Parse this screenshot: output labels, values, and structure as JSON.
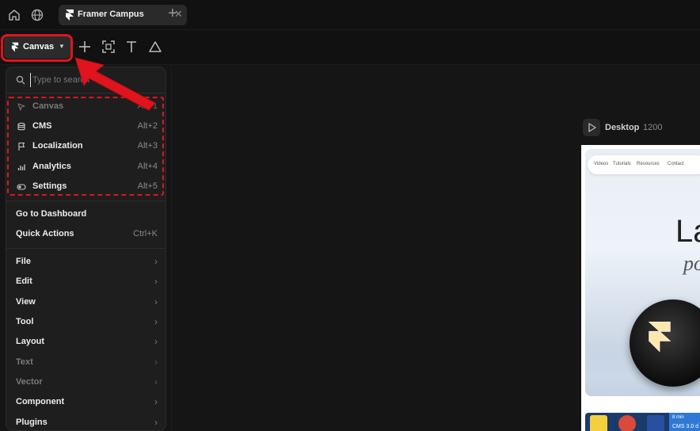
{
  "browser": {
    "tab_title": "Framer Campus",
    "tab_close": "✕",
    "new_tab": "+"
  },
  "toolbar": {
    "canvas_label": "Canvas",
    "chevron": "⌄"
  },
  "menu": {
    "search_placeholder": "Type to search",
    "modes": [
      {
        "label": "Canvas",
        "shortcut": "Alt+1",
        "icon": "pointer-icon"
      },
      {
        "label": "CMS",
        "shortcut": "Alt+2",
        "icon": "database-icon"
      },
      {
        "label": "Localization",
        "shortcut": "Alt+3",
        "icon": "flag-icon"
      },
      {
        "label": "Analytics",
        "shortcut": "Alt+4",
        "icon": "bar-chart-icon"
      },
      {
        "label": "Settings",
        "shortcut": "Alt+5",
        "icon": "toggle-icon"
      }
    ],
    "actions": [
      {
        "label": "Go to Dashboard",
        "shortcut": ""
      },
      {
        "label": "Quick Actions",
        "shortcut": "Ctrl+K"
      }
    ],
    "submenus": [
      {
        "label": "File",
        "enabled": true
      },
      {
        "label": "Edit",
        "enabled": true
      },
      {
        "label": "View",
        "enabled": true
      },
      {
        "label": "Tool",
        "enabled": true
      },
      {
        "label": "Layout",
        "enabled": true
      },
      {
        "label": "Text",
        "enabled": false
      },
      {
        "label": "Vector",
        "enabled": false
      },
      {
        "label": "Component",
        "enabled": true
      },
      {
        "label": "Plugins",
        "enabled": true
      }
    ],
    "submenu_arrow": "›"
  },
  "frame": {
    "name": "Desktop",
    "width": "1200",
    "nav_links": [
      "Videos",
      "Tutorials",
      "Resources",
      "Contact"
    ],
    "hero_title": "La",
    "hero_subtitle": "po",
    "strip_time": "8 min",
    "strip_text": "CMS 3.0 d"
  },
  "colors": {
    "highlight": "#e0141e",
    "menu_bg": "#1e1e1e",
    "app_bg": "#151515"
  }
}
